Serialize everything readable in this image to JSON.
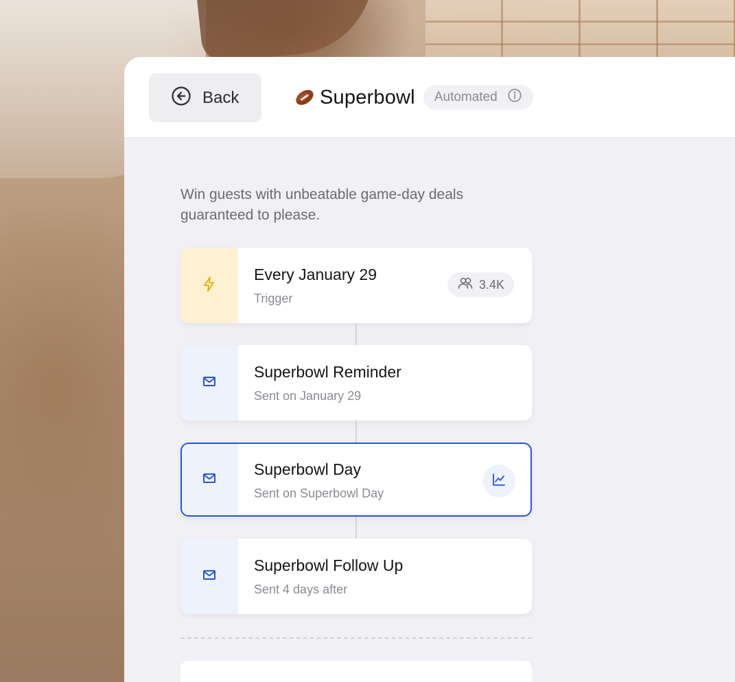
{
  "header": {
    "back_label": "Back",
    "title": "Superbowl",
    "status_badge": "Automated"
  },
  "description": "Win guests with unbeatable game-day deals guaranteed to please.",
  "flow": {
    "trigger": {
      "title": "Every January 29",
      "subtitle": "Trigger",
      "audience_count": "3.4K",
      "icon": "lightning-icon"
    },
    "steps": [
      {
        "title": "Superbowl Reminder",
        "subtitle": "Sent on January 29",
        "icon": "mail-icon",
        "selected": false
      },
      {
        "title": "Superbowl Day",
        "subtitle": "Sent on Superbowl Day",
        "icon": "mail-icon",
        "selected": true
      },
      {
        "title": "Superbowl Follow Up",
        "subtitle": "Sent 4 days after",
        "icon": "mail-icon",
        "selected": false
      }
    ]
  },
  "colors": {
    "accent": "#2354d8",
    "trigger_accent": "#e8a900",
    "trigger_bg": "#fdf1d2",
    "email_bg": "#eef2fd"
  }
}
